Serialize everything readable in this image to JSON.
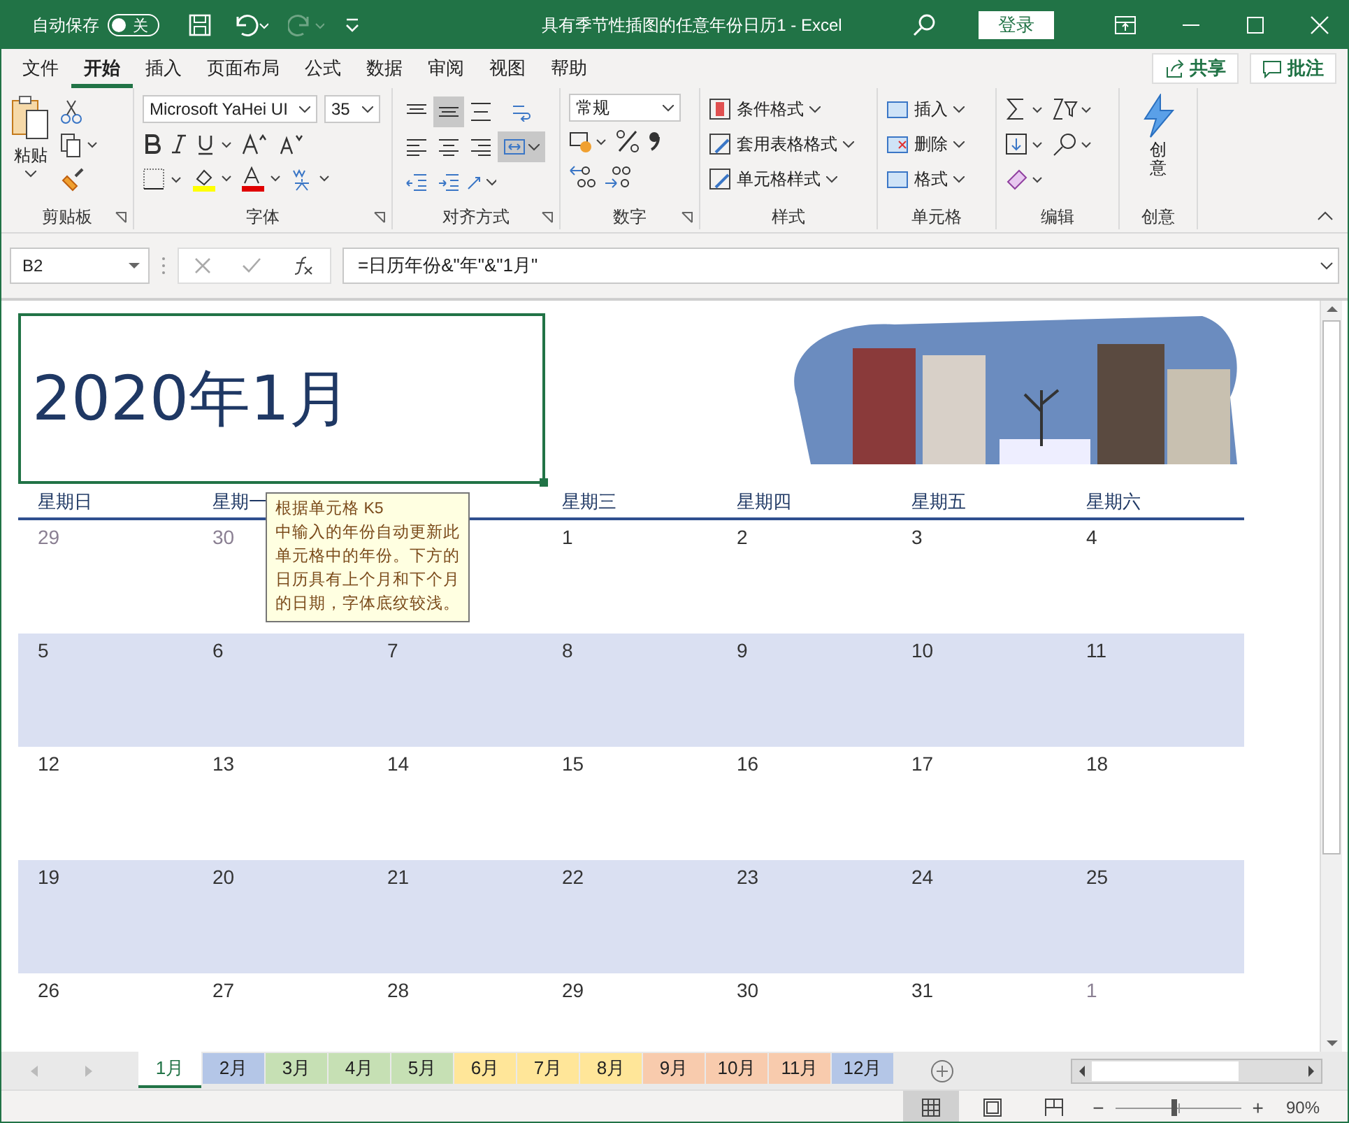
{
  "title_bar": {
    "autosave_label": "自动保存",
    "autosave": {
      "on": false,
      "label": "关"
    },
    "title": "具有季节性插图的任意年份日历1  -  Excel",
    "login": "登录"
  },
  "ribbon_tabs": [
    {
      "label": "文件",
      "selected": false
    },
    {
      "label": "开始",
      "selected": true
    },
    {
      "label": "插入",
      "selected": false
    },
    {
      "label": "页面布局",
      "selected": false
    },
    {
      "label": "公式",
      "selected": false
    },
    {
      "label": "数据",
      "selected": false
    },
    {
      "label": "审阅",
      "selected": false
    },
    {
      "label": "视图",
      "selected": false
    },
    {
      "label": "帮助",
      "selected": false
    }
  ],
  "share": "共享",
  "comments": "批注",
  "ribbon": {
    "clipboard": {
      "paste": "粘贴",
      "label": "剪贴板"
    },
    "font": {
      "name": "Microsoft YaHei UI",
      "size": "35",
      "label": "字体"
    },
    "alignment": {
      "label": "对齐方式",
      "buttons": [
        {
          "kind": "top",
          "selected": false
        },
        {
          "kind": "middle",
          "selected": true
        },
        {
          "kind": "bottom",
          "selected": false
        },
        {
          "kind": "wrap",
          "selected": false
        },
        {
          "kind": "left",
          "selected": false
        },
        {
          "kind": "center",
          "selected": false
        },
        {
          "kind": "right",
          "selected": false
        },
        {
          "kind": "merge",
          "selected": true
        },
        {
          "kind": "outdent",
          "selected": false
        },
        {
          "kind": "indent",
          "selected": false
        },
        {
          "kind": "orient",
          "selected": false
        }
      ]
    },
    "number": {
      "format": "常规",
      "label": "数字"
    },
    "styles": {
      "items": [
        "条件格式",
        "套用表格格式",
        "单元格样式"
      ],
      "label": "样式"
    },
    "cells": {
      "items": [
        "插入",
        "删除",
        "格式"
      ],
      "label": "单元格"
    },
    "editing": {
      "label": "编辑"
    },
    "ideas": {
      "button": "创意",
      "label": "创意"
    }
  },
  "formula_bar": {
    "name_box": "B2",
    "formula": "=日历年份&\"年\"&\"1月\""
  },
  "sheet": {
    "title": "2020年1月",
    "weekdays": [
      {
        "text": "星期日",
        "covered": false
      },
      {
        "text": "星期一",
        "covered": false
      },
      {
        "covered": true
      },
      {
        "text": "星期三",
        "covered": false
      },
      {
        "text": "星期四",
        "covered": false
      },
      {
        "text": "星期五",
        "covered": false
      },
      {
        "text": "星期六",
        "covered": false
      }
    ],
    "weeks": [
      {
        "shaded": false,
        "days": [
          {
            "text": "29",
            "other_month": true
          },
          {
            "text": "30",
            "other_month": true
          },
          {
            "covered": true
          },
          {
            "text": "1",
            "other_month": false
          },
          {
            "text": "2",
            "other_month": false
          },
          {
            "text": "3",
            "other_month": false
          },
          {
            "text": "4",
            "other_month": false
          }
        ]
      },
      {
        "shaded": true,
        "days": [
          {
            "text": "5",
            "other_month": false
          },
          {
            "text": "6",
            "other_month": false
          },
          {
            "text": "7",
            "other_month": false
          },
          {
            "text": "8",
            "other_month": false
          },
          {
            "text": "9",
            "other_month": false
          },
          {
            "text": "10",
            "other_month": false
          },
          {
            "text": "11",
            "other_month": false
          }
        ]
      },
      {
        "shaded": false,
        "days": [
          {
            "text": "12",
            "other_month": false
          },
          {
            "text": "13",
            "other_month": false
          },
          {
            "text": "14",
            "other_month": false
          },
          {
            "text": "15",
            "other_month": false
          },
          {
            "text": "16",
            "other_month": false
          },
          {
            "text": "17",
            "other_month": false
          },
          {
            "text": "18",
            "other_month": false
          }
        ]
      },
      {
        "shaded": true,
        "days": [
          {
            "text": "19",
            "other_month": false
          },
          {
            "text": "20",
            "other_month": false
          },
          {
            "text": "21",
            "other_month": false
          },
          {
            "text": "22",
            "other_month": false
          },
          {
            "text": "23",
            "other_month": false
          },
          {
            "text": "24",
            "other_month": false
          },
          {
            "text": "25",
            "other_month": false
          }
        ]
      },
      {
        "shaded": false,
        "days": [
          {
            "text": "26",
            "other_month": false
          },
          {
            "text": "27",
            "other_month": false
          },
          {
            "text": "28",
            "other_month": false
          },
          {
            "text": "29",
            "other_month": false
          },
          {
            "text": "30",
            "other_month": false
          },
          {
            "text": "31",
            "other_month": false
          },
          {
            "text": "1",
            "other_month": true
          }
        ]
      }
    ],
    "tooltip": {
      "title": "根据单元格 K5",
      "body": "中输入的年份自动更新此单元格中的年份。下方的日历具有上个月和下个月的日期，字体底纹较浅。"
    }
  },
  "sheet_tabs": [
    {
      "label": "1月",
      "color": "#ffffff",
      "selected": true
    },
    {
      "label": "2月",
      "color": "#b4c6e7",
      "selected": false
    },
    {
      "label": "3月",
      "color": "#c6e0b4",
      "selected": false
    },
    {
      "label": "4月",
      "color": "#c6e0b4",
      "selected": false
    },
    {
      "label": "5月",
      "color": "#c6e0b4",
      "selected": false
    },
    {
      "label": "6月",
      "color": "#ffe699",
      "selected": false
    },
    {
      "label": "7月",
      "color": "#ffe699",
      "selected": false
    },
    {
      "label": "8月",
      "color": "#ffe699",
      "selected": false
    },
    {
      "label": "9月",
      "color": "#f8cbad",
      "selected": false
    },
    {
      "label": "10月",
      "color": "#f8cbad",
      "selected": false
    },
    {
      "label": "11月",
      "color": "#f8cbad",
      "selected": false
    },
    {
      "label": "12月",
      "color": "#b4c6e7",
      "selected": false
    }
  ],
  "status_bar": {
    "views": [
      {
        "kind": "normal",
        "selected": true
      },
      {
        "kind": "layout",
        "selected": false
      },
      {
        "kind": "break",
        "selected": false
      }
    ],
    "zoom": {
      "out": "−",
      "in": "+",
      "level": 0.47,
      "reading": "90%"
    }
  }
}
